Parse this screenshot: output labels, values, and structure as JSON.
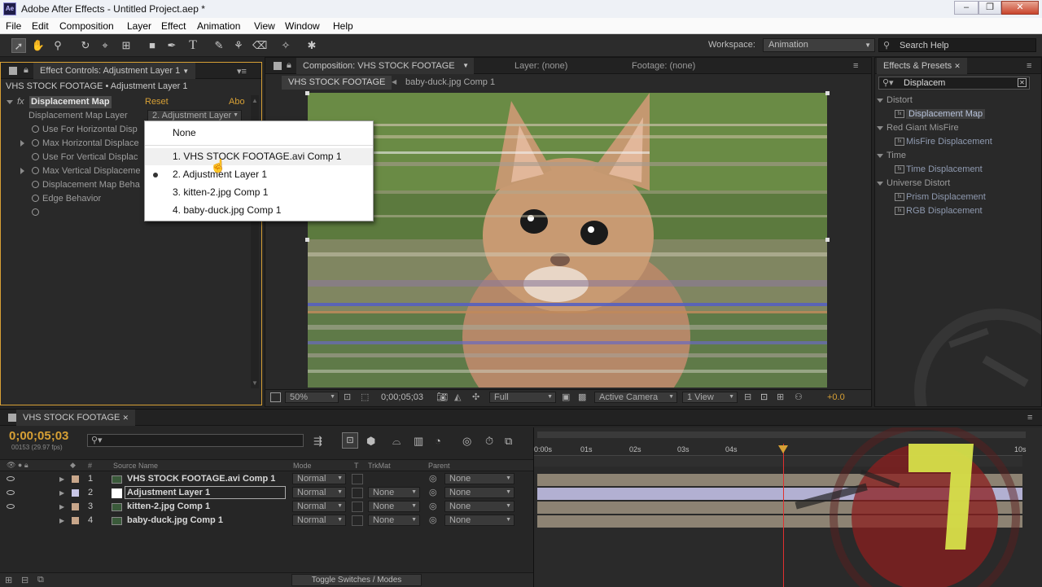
{
  "app": {
    "badge": "Ae",
    "title": "Adobe After Effects - Untitled Project.aep *"
  },
  "window_buttons": {
    "minimize": "‒",
    "restore": "❐",
    "close": "✕"
  },
  "menu": [
    "File",
    "Edit",
    "Composition",
    "Layer",
    "Effect",
    "Animation",
    "View",
    "Window",
    "Help"
  ],
  "toolbar": {
    "workspace_label": "Workspace:",
    "workspace_value": "Animation",
    "search_placeholder": "Search Help"
  },
  "effect_controls": {
    "tab": "Effect Controls: Adjustment Layer 1",
    "breadcrumb": "VHS STOCK FOOTAGE • Adjustment Layer 1",
    "effect_name": "Displacement Map",
    "reset": "Reset",
    "about": "Abo",
    "props": [
      {
        "label": "Displacement Map Layer"
      },
      {
        "label": "Use For Horizontal Disp"
      },
      {
        "label": "Max Horizontal Displace"
      },
      {
        "label": "Use For Vertical Displac"
      },
      {
        "label": "Max Vertical Displaceme"
      },
      {
        "label": "Displacement Map Beha"
      },
      {
        "label": "Edge Behavior"
      },
      {
        "label": ""
      }
    ],
    "layer_dropdown_value": "2. Adjustment Layer"
  },
  "popup": {
    "items": [
      "None",
      "1. VHS STOCK FOOTAGE.avi Comp 1",
      "2. Adjustment Layer 1",
      "3. kitten-2.jpg Comp 1",
      "4. baby-duck.jpg Comp 1"
    ],
    "selected_index": 2,
    "hover_index": 1
  },
  "composition": {
    "tab": "Composition: VHS STOCK FOOTAGE",
    "layer_tab": "Layer: (none)",
    "footage_tab": "Footage: (none)",
    "crumb_active": "VHS STOCK FOOTAGE",
    "crumb_next": "baby-duck.jpg Comp 1",
    "footer": {
      "zoom": "50%",
      "timecode": "0;00;05;03",
      "resolution": "Full",
      "camera": "Active Camera",
      "views": "1 View",
      "exposure": "+0.0"
    }
  },
  "effects_presets": {
    "tab": "Effects & Presets",
    "search_value": "Displacem",
    "tree": [
      {
        "type": "cat",
        "label": "Distort"
      },
      {
        "type": "fx",
        "label": "Displacement Map",
        "selected": true
      },
      {
        "type": "cat",
        "label": "Red Giant MisFire"
      },
      {
        "type": "fx",
        "label": "MisFire Displacement"
      },
      {
        "type": "cat",
        "label": "Time"
      },
      {
        "type": "fx",
        "label": "Time Displacement"
      },
      {
        "type": "cat",
        "label": "Universe Distort"
      },
      {
        "type": "fx",
        "label": "Prism Displacement"
      },
      {
        "type": "fx",
        "label": "RGB Displacement"
      }
    ]
  },
  "timeline": {
    "tab": "VHS STOCK FOOTAGE",
    "timecode": "0;00;05;03",
    "frame_info": "00153 (29.97 fps)",
    "headers": {
      "num": "#",
      "source": "Source Name",
      "mode": "Mode",
      "t": "T",
      "trkmat": "TrkMat",
      "parent": "Parent"
    },
    "ruler": [
      "0:00s",
      "01s",
      "02s",
      "03s",
      "04s",
      "10s"
    ],
    "layers": [
      {
        "num": "1",
        "name": "VHS STOCK FOOTAGE.avi Comp 1",
        "mode": "Normal",
        "trkmat": "",
        "parent": "None",
        "color": "#c8a68a"
      },
      {
        "num": "2",
        "name": "Adjustment Layer 1",
        "mode": "Normal",
        "trkmat": "None",
        "parent": "None",
        "color": "#c8c6e6"
      },
      {
        "num": "3",
        "name": "kitten-2.jpg Comp 1",
        "mode": "Normal",
        "trkmat": "None",
        "parent": "None",
        "color": "#c8a68a"
      },
      {
        "num": "4",
        "name": "baby-duck.jpg Comp 1",
        "mode": "Normal",
        "trkmat": "None",
        "parent": "None",
        "color": "#c8a68a"
      }
    ],
    "toggle_label": "Toggle Switches / Modes"
  },
  "colors": {
    "accent": "#d7a035",
    "panel_bg": "#292929",
    "track_bar": "#bcae95",
    "adj_bar": "#b2b0d2"
  }
}
